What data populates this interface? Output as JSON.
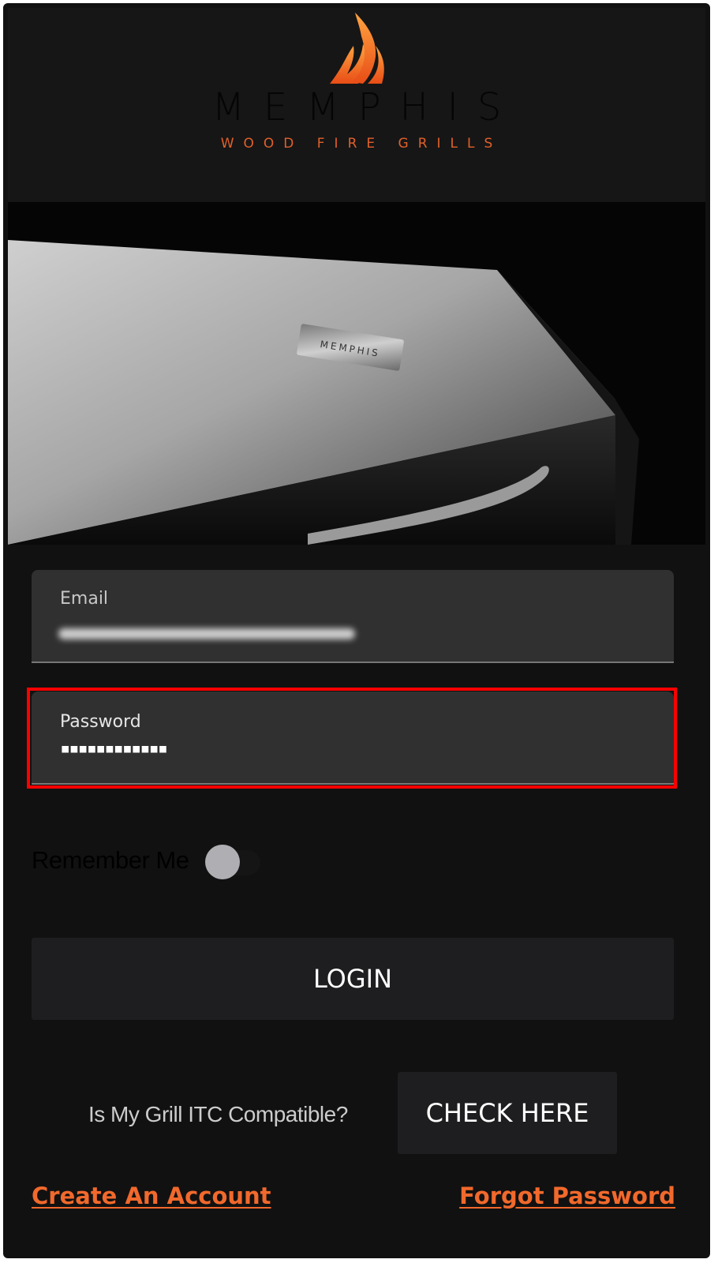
{
  "header": {
    "brand_name": "MEMPHIS",
    "brand_tagline": "WOOD FIRE GRILLS"
  },
  "hero": {
    "badge_text": "MEMPHIS"
  },
  "form": {
    "email_label": "Email",
    "password_label": "Password",
    "password_masked": "▪▪▪▪▪▪▪▪▪▪▪▪",
    "remember_label": "Remember Me",
    "remember_on": false,
    "login_label": "LOGIN"
  },
  "compat": {
    "question": "Is My Grill ITC Compatible?",
    "button_label": "CHECK HERE"
  },
  "links": {
    "create_account": "Create An Account",
    "forgot_password": "Forgot Password"
  },
  "colors": {
    "background": "#111111",
    "accent": "#f1692c",
    "highlight": "#ff0000"
  },
  "icons": [
    "flame-logo-icon"
  ]
}
